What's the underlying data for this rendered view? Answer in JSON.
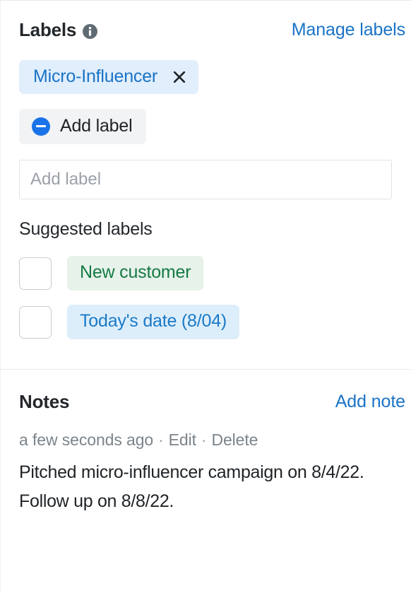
{
  "labels": {
    "title": "Labels",
    "info_icon": "info-icon",
    "manage_link": "Manage labels",
    "applied": [
      {
        "text": "Micro-Influencer",
        "remove_icon": "close-icon"
      }
    ],
    "add_label_button": {
      "label": "Add label",
      "icon": "minus-circle-icon"
    },
    "input": {
      "placeholder": "Add label",
      "value": ""
    },
    "suggested_title": "Suggested labels",
    "suggested": [
      {
        "text": "New customer",
        "checked": false,
        "color": "#137a43",
        "background": "#e7f2ea"
      },
      {
        "text": "Today's date (8/04)",
        "checked": false,
        "color": "#1a7ac7",
        "background": "#ddeefb"
      }
    ]
  },
  "notes": {
    "title": "Notes",
    "add_link": "Add note",
    "items": [
      {
        "timestamp": "a few seconds ago",
        "separator": "·",
        "edit_label": "Edit",
        "delete_label": "Delete",
        "body": "Pitched micro-influencer campaign on 8/4/22. Follow up on 8/8/22."
      }
    ]
  },
  "theme": {
    "link_blue": "#1a73c7",
    "accent_blue": "#1a73e8",
    "text_dark": "#1f2327",
    "text_muted": "#7b848b",
    "chip_blue_bg": "#e1eefb",
    "chip_green_bg": "#e7f2ea",
    "divider": "#e6eaed"
  }
}
